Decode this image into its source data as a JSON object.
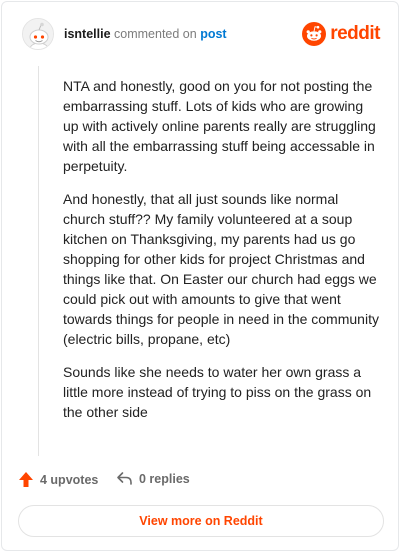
{
  "header": {
    "username": "isntellie",
    "action_text": "commented on",
    "post_link_text": "post",
    "brand_name": "reddit"
  },
  "comment": {
    "paragraphs": [
      "NTA and honestly, good on you for not posting the embarrassing stuff. Lots of kids who are growing up with actively online parents really are struggling with all the embarrassing stuff being accessable in perpetuity.",
      "And honestly, that all just sounds like normal church stuff?? My family volunteered at a soup kitchen on Thanksgiving, my parents had us go shopping for other kids for project Christmas and things like that. On Easter our church had eggs we could pick out with amounts to give that went towards things for people in need in the community (electric bills, propane, etc)",
      "Sounds like she needs to water her own grass a little more instead of trying to piss on the grass on the other side"
    ]
  },
  "footer": {
    "upvotes_label": "4 upvotes",
    "replies_label": "0 replies"
  },
  "cta": {
    "label": "View more on Reddit"
  },
  "icons": {
    "avatar": "snoo-avatar-icon",
    "brand": "reddit-logo-icon",
    "upvote": "upvote-arrow-icon",
    "reply": "reply-arrow-icon"
  },
  "colors": {
    "brand": "#ff4500",
    "link": "#0079d3",
    "muted": "#7c7c7c"
  }
}
